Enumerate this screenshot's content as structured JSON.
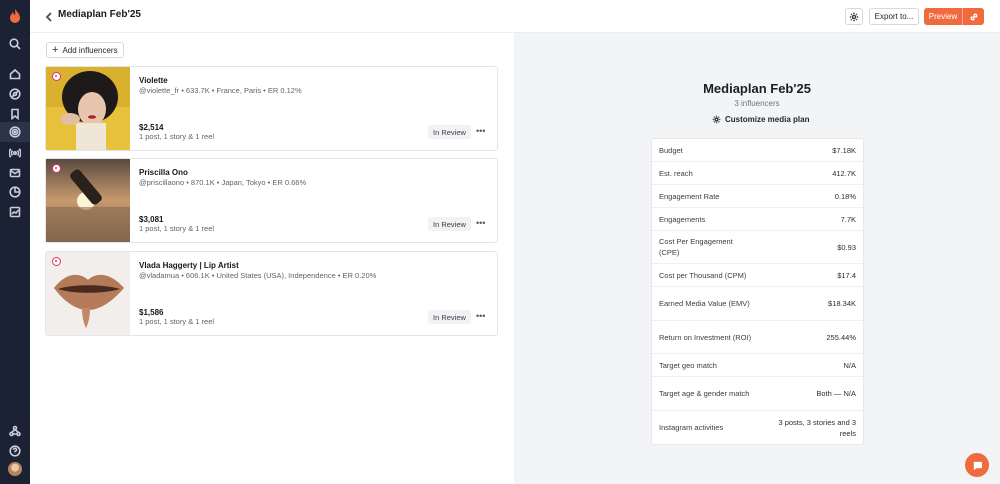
{
  "header": {
    "title": "Mediaplan Feb'25",
    "export_label": "Export to...",
    "preview_label": "Preview"
  },
  "sidebar": {
    "icons": [
      "home-icon",
      "compass-icon",
      "bookmark-icon",
      "target-icon",
      "broadcast-icon",
      "mail-icon",
      "pie-chart-icon",
      "trend-icon",
      "network-icon",
      "help-icon"
    ]
  },
  "left": {
    "add_label": "Add influencers",
    "influencers": [
      {
        "name": "Violette",
        "meta": "@violette_fr • 633.7K • France, Paris • ER 0.12%",
        "price": "$2,514",
        "deliverables": "1 post, 1 story & 1 reel",
        "status": "In Review"
      },
      {
        "name": "Priscilla Ono",
        "meta": "@priscillaono • 870.1K • Japan, Tokyo • ER 0.66%",
        "price": "$3,081",
        "deliverables": "1 post, 1 story & 1 reel",
        "status": "In Review"
      },
      {
        "name": "Vlada Haggerty | Lip Artist",
        "meta": "@vladamua • 606.1K • United States (USA), Independence • ER 0.20%",
        "price": "$1,586",
        "deliverables": "1 post, 1 story & 1 reel",
        "status": "In Review"
      }
    ]
  },
  "right": {
    "title": "Mediaplan Feb'25",
    "subtitle": "3 influencers",
    "customize_label": "Customize media plan",
    "metrics": [
      {
        "label": "Budget",
        "value": "$7.18K"
      },
      {
        "label": "Est. reach",
        "value": "412.7K"
      },
      {
        "label": "Engagement Rate",
        "value": "0.18%"
      },
      {
        "label": "Engagements",
        "value": "7.7K"
      },
      {
        "label": "Cost Per Engagement (CPE)",
        "value": "$0.93"
      },
      {
        "label": "Cost per Thousand (CPM)",
        "value": "$17.4"
      },
      {
        "label": "Earned Media Value (EMV)",
        "value": "$18.34K"
      },
      {
        "label": "Return on Investment (ROI)",
        "value": "255.44%"
      },
      {
        "label": "Target geo match",
        "value": "N/A"
      },
      {
        "label": "Target age & gender match",
        "value": "Both — N/A"
      },
      {
        "label": "Instagram activities",
        "value": "3 posts, 3 stories and 3 reels"
      }
    ]
  },
  "colors": {
    "accent": "#f06a3f",
    "sidebar": "#1b2233",
    "panel": "#f3f4f6"
  }
}
